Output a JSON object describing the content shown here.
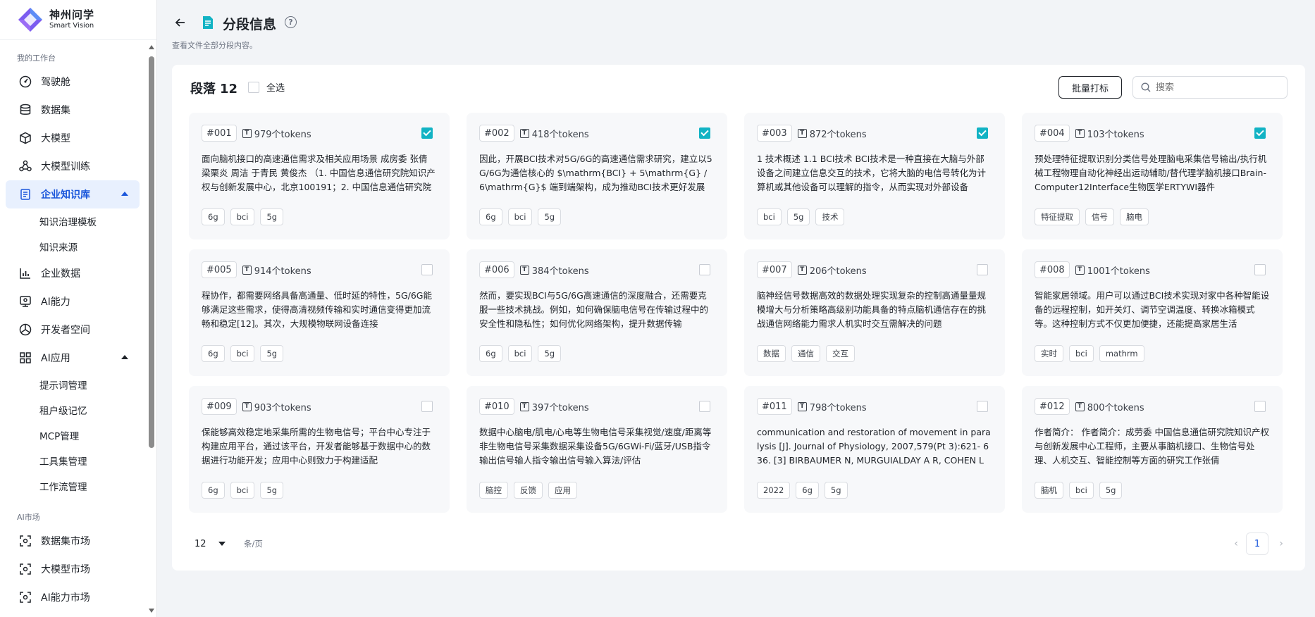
{
  "brand": {
    "title": "神州问学",
    "subtitle": "Smart Vision"
  },
  "sidebar": {
    "group1": "我的工作台",
    "items": [
      {
        "label": "驾驶舱",
        "icon": "dashboard-icon"
      },
      {
        "label": "数据集",
        "icon": "database-icon"
      },
      {
        "label": "大模型",
        "icon": "cube-icon"
      },
      {
        "label": "大模型训练",
        "icon": "training-icon"
      },
      {
        "label": "企业知识库",
        "icon": "knowledge-icon",
        "active": true
      },
      {
        "label": "企业数据",
        "icon": "chart-icon"
      },
      {
        "label": "AI能力",
        "icon": "ai-capability-icon"
      },
      {
        "label": "开发者空间",
        "icon": "developer-icon"
      },
      {
        "label": "AI应用",
        "icon": "apps-icon"
      }
    ],
    "kb_sub": [
      "知识治理模板",
      "知识来源"
    ],
    "app_sub": [
      "提示词管理",
      "租户级记忆",
      "MCP管理",
      "工具集管理",
      "工作流管理"
    ],
    "group2": "AI市场",
    "market": [
      {
        "label": "数据集市场"
      },
      {
        "label": "大模型市场"
      },
      {
        "label": "AI能力市场"
      }
    ]
  },
  "header": {
    "title": "分段信息",
    "desc": "查看文件全部分段内容。"
  },
  "panel": {
    "title": "段落",
    "count": "12",
    "select_all": "全选",
    "batch_label": "批量打标",
    "search_placeholder": "搜索"
  },
  "cards": [
    {
      "seq": "#001",
      "tokens": "979个tokens",
      "checked": true,
      "text": "面向脑机接口的高速通信需求及相关应用场景 成房委 张倩 梁栗炎 周洁 于青民 黄俊杰 （1. 中国信息通信研究院知识产权与创新发展中心，北京100191；2. 中国信息通信研究院",
      "tags": [
        "6g",
        "bci",
        "5g"
      ]
    },
    {
      "seq": "#002",
      "tokens": "418个tokens",
      "checked": true,
      "text": "因此，开展BCI技术对5G/6G的高速通信需求研究，建立以5G/6G为通信核心的 $\\mathrm{BCI} + 5\\mathrm{G} / 6\\mathrm{G}$ 端到端架构，成为推动BCI技术更好发展",
      "tags": [
        "6g",
        "bci",
        "5g"
      ]
    },
    {
      "seq": "#003",
      "tokens": "872个tokens",
      "checked": true,
      "text": "1 技术概述 1.1 BCI技术 BCI技术是一种直接在大脑与外部设备之间建立信息交互的技术，它将大脑的电信号转化为计算机或其他设备可以理解的指令，从而实现对外部设备",
      "tags": [
        "bci",
        "5g",
        "技术"
      ]
    },
    {
      "seq": "#004",
      "tokens": "103个tokens",
      "checked": true,
      "text": "预处理特征提取识别分类信号处理脑电采集信号输出/执行机械工程物理自动化神经出运动辅助/替代理学脑机接口Brain-Computer12Interface生物医学ERTYWI器件",
      "tags": [
        "特征提取",
        "信号",
        "脑电"
      ]
    },
    {
      "seq": "#005",
      "tokens": "914个tokens",
      "checked": false,
      "text": "程协作，都需要网络具备高通量、低时延的特性，5G/6G能够满足这些需求，使得高清视频传输和实时通信变得更加流畅和稳定[12]。其次，大规模物联网设备连接",
      "tags": [
        "6g",
        "bci",
        "5g"
      ]
    },
    {
      "seq": "#006",
      "tokens": "384个tokens",
      "checked": false,
      "text": "然而，要实现BCI与5G/6G高速通信的深度融合，还需要克服一些技术挑战。例如，如何确保脑电信号在传输过程中的安全性和隐私性；如何优化网络架构，提升数据传输",
      "tags": [
        "6g",
        "bci",
        "5g"
      ]
    },
    {
      "seq": "#007",
      "tokens": "206个tokens",
      "checked": false,
      "text": "脑神经信号数据高效的数据处理实现复杂的控制高通量量规模增大与分析策略高级别功能具备的特点脑机通信存在的挑战通信网络能力需求人机实时交互需解决的问题",
      "tags": [
        "数据",
        "通信",
        "交互"
      ]
    },
    {
      "seq": "#008",
      "tokens": "1001个tokens",
      "checked": false,
      "text": "智能家居领域。用户可以通过BCI技术实现对家中各种智能设备的远程控制，如开关灯、调节空调温度、转换冰箱模式等。这种控制方式不仅更加便捷，还能提高家居生活",
      "tags": [
        "实时",
        "bci",
        "mathrm"
      ]
    },
    {
      "seq": "#009",
      "tokens": "903个tokens",
      "checked": false,
      "text": "保能够高效稳定地采集所需的生物电信号；平台中心专注于构建应用平台，通过该平台，开发者能够基于数据中心的数据进行功能开发；应用中心则致力于构建适配",
      "tags": [
        "6g",
        "bci",
        "5g"
      ]
    },
    {
      "seq": "#010",
      "tokens": "397个tokens",
      "checked": false,
      "text": "数据中心脑电/肌电/心电等生物电信号采集视觉/速度/距离等非生物电信号采集数据采集设备5G/6GWi-Fi/蓝牙/USB指令输出信号输人指令输出信号输入算法/评估",
      "tags": [
        "脑控",
        "反馈",
        "应用"
      ]
    },
    {
      "seq": "#011",
      "tokens": "798个tokens",
      "checked": false,
      "text": "communication and restoration of movement in paralysis [J]. Journal of Physiology, 2007,579(Pt 3):621- 636. [3] BIRBAUMER N, MURGUIALDAY A R, COHEN L",
      "tags": [
        "2022",
        "6g",
        "5g"
      ]
    },
    {
      "seq": "#012",
      "tokens": "800个tokens",
      "checked": false,
      "text": "作者简介： 作者简介：成劳委 中国信息通信研究院知识产权与创新发展中心工程师，主要从事脑机接口、生物信号处理、人机交互、智能控制等方面的研究工作张倩",
      "tags": [
        "脑机",
        "bci",
        "5g"
      ]
    }
  ],
  "pager": {
    "size": "12",
    "per_page": "条/页",
    "current": "1"
  },
  "colors": {
    "accent": "#1a56db",
    "check": "#12b3c4"
  }
}
